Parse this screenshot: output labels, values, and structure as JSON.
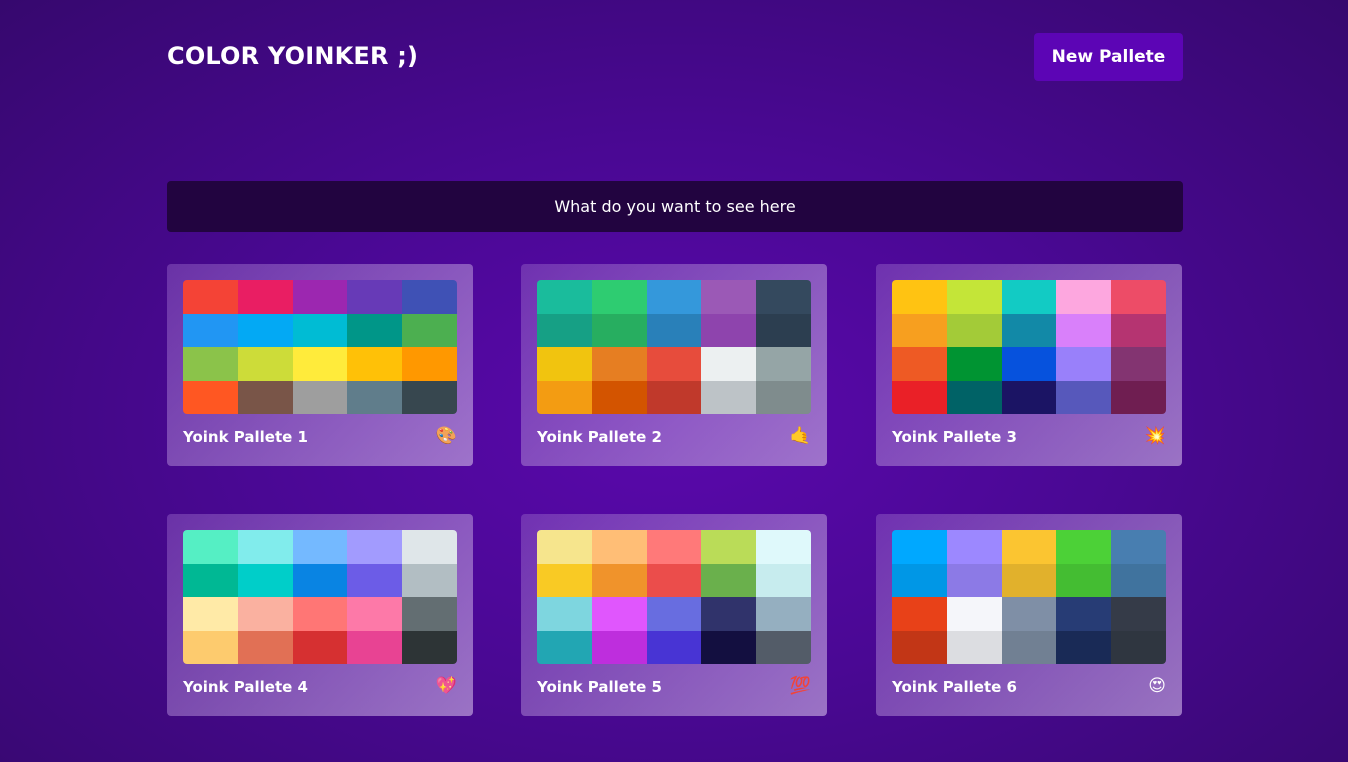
{
  "header": {
    "title": "COLOR YOINKER ;)",
    "new_button": "New Pallete"
  },
  "search": {
    "placeholder": "What do you want to see here"
  },
  "palettes": [
    {
      "name": "Yoink Pallete 1",
      "emoji": "🎨",
      "colors": [
        "#f44336",
        "#e91e63",
        "#9c27b0",
        "#673ab7",
        "#3f51b5",
        "#2196f3",
        "#03a9f4",
        "#00bcd4",
        "#009688",
        "#4caf50",
        "#8bc34a",
        "#cddc39",
        "#ffeb3b",
        "#ffc107",
        "#ff9800",
        "#ff5722",
        "#795548",
        "#9e9e9e",
        "#607d8b",
        "#37474f"
      ]
    },
    {
      "name": "Yoink Pallete 2",
      "emoji": "🤙",
      "colors": [
        "#1abc9c",
        "#2ecc71",
        "#3498db",
        "#9b59b6",
        "#34495e",
        "#16a085",
        "#27ae60",
        "#2980b9",
        "#8e44ad",
        "#2c3e50",
        "#f1c40f",
        "#e67e22",
        "#e74c3c",
        "#ecf0f1",
        "#95a5a6",
        "#f39c12",
        "#d35400",
        "#c0392b",
        "#bdc3c7",
        "#7f8c8d"
      ]
    },
    {
      "name": "Yoink Pallete 3",
      "emoji": "💥",
      "colors": [
        "#ffc312",
        "#c4e538",
        "#12cbc4",
        "#fda7df",
        "#ed4c67",
        "#f79f1f",
        "#a3cb38",
        "#1289a7",
        "#d980fa",
        "#b53471",
        "#ee5a24",
        "#009432",
        "#0652dd",
        "#9980fa",
        "#833471",
        "#ea2027",
        "#006266",
        "#1b1464",
        "#5758bb",
        "#6f1e51"
      ]
    },
    {
      "name": "Yoink Pallete 4",
      "emoji": "💖",
      "colors": [
        "#55efc4",
        "#81ecec",
        "#74b9ff",
        "#a29bfe",
        "#dfe6e9",
        "#00b894",
        "#00cec9",
        "#0984e3",
        "#6c5ce7",
        "#b2bec3",
        "#ffeaa7",
        "#fab1a0",
        "#ff7675",
        "#fd79a8",
        "#636e72",
        "#fdcb6e",
        "#e17055",
        "#d63031",
        "#e84393",
        "#2d3436"
      ]
    },
    {
      "name": "Yoink Pallete 5",
      "emoji": "💯",
      "colors": [
        "#f6e58d",
        "#ffbe76",
        "#ff7979",
        "#badc58",
        "#dff9fb",
        "#f9ca24",
        "#f0932b",
        "#eb4d4b",
        "#6ab04c",
        "#c7ecee",
        "#7ed6df",
        "#e056fd",
        "#686de0",
        "#30336b",
        "#95afc0",
        "#22a6b3",
        "#be2edd",
        "#4834d4",
        "#130f40",
        "#535c68"
      ]
    },
    {
      "name": "Yoink Pallete 6",
      "emoji": "😍",
      "colors": [
        "#00a8ff",
        "#9c88ff",
        "#fbc531",
        "#4cd137",
        "#487eb0",
        "#0097e6",
        "#8c7ae6",
        "#e1b12c",
        "#44bd32",
        "#40739e",
        "#e84118",
        "#f5f6fa",
        "#7f8fa6",
        "#273c75",
        "#353b48",
        "#c23616",
        "#dcdde1",
        "#718093",
        "#192a56",
        "#2f3640"
      ]
    }
  ]
}
